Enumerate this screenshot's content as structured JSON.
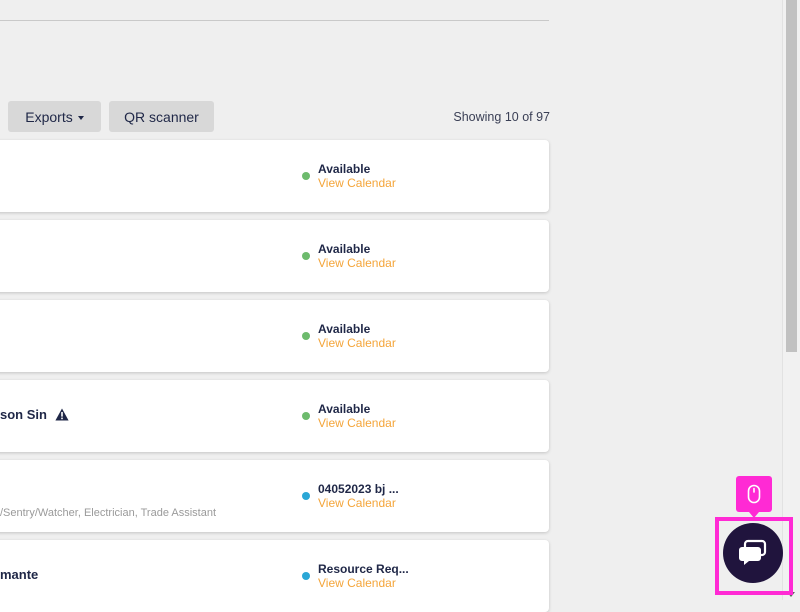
{
  "toolbar": {
    "exports_label": "Exports",
    "qr_label": "QR scanner",
    "showing_text": "Showing 10 of 97"
  },
  "colors": {
    "available": "#6dbb6d",
    "info": "#2aa7d6",
    "link": "#f4a53a",
    "accent": "#ff2ad4",
    "chat": "#20143d"
  },
  "cards": [
    {
      "title": "",
      "subtitle": "",
      "status": "Available",
      "status_type": "available",
      "link": "View Calendar",
      "warning": false
    },
    {
      "title": "",
      "subtitle": "",
      "status": "Available",
      "status_type": "available",
      "link": "View Calendar",
      "warning": false
    },
    {
      "title": "",
      "subtitle": "",
      "status": "Available",
      "status_type": "available",
      "link": "View Calendar",
      "warning": false
    },
    {
      "title": "son Sin",
      "subtitle": "",
      "status": "Available",
      "status_type": "available",
      "link": "View Calendar",
      "warning": true
    },
    {
      "title": "",
      "subtitle": "/Sentry/Watcher, Electrician, Trade Assistant",
      "status": "04052023 bj ...",
      "status_type": "info",
      "link": "View Calendar",
      "warning": false
    },
    {
      "title": "mante",
      "subtitle": "",
      "status": "Resource Req...",
      "status_type": "info",
      "link": "View Calendar",
      "warning": false
    }
  ],
  "icons": {
    "warning": "warning-triangle-icon",
    "mouse": "mouse-icon",
    "chat": "chat-bubble-icon"
  }
}
